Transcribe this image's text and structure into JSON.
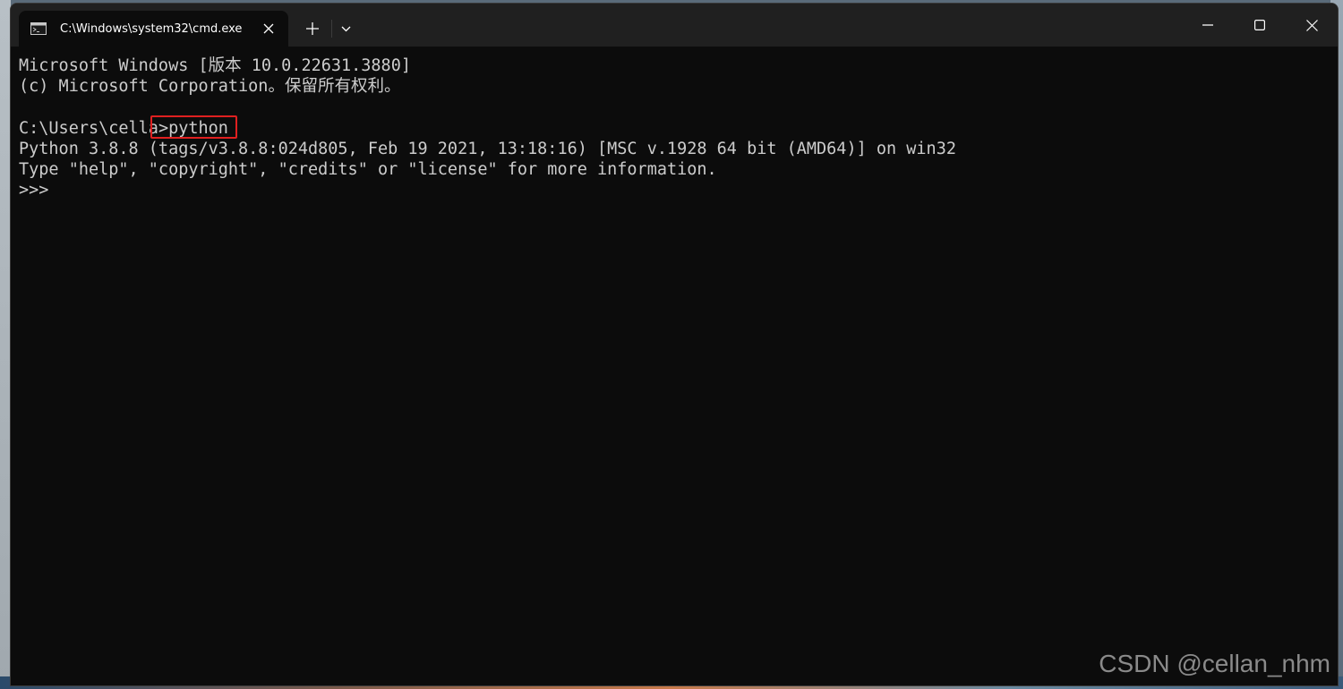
{
  "window": {
    "tab_title": "C:\\Windows\\system32\\cmd.exe",
    "controls": {
      "minimize_icon": "minimize-icon",
      "maximize_icon": "maximize-icon",
      "close_icon": "close-icon"
    }
  },
  "terminal": {
    "lines": [
      "Microsoft Windows [版本 10.0.22631.3880]",
      "(c) Microsoft Corporation。保留所有权利。",
      "",
      "C:\\Users\\cella>python",
      "Python 3.8.8 (tags/v3.8.8:024d805, Feb 19 2021, 13:18:16) [MSC v.1928 64 bit (AMD64)] on win32",
      "Type \"help\", \"copyright\", \"credits\" or \"license\" for more information.",
      ">>>"
    ],
    "prompt_prefix": "C:\\Users\\cella",
    "command": ">python",
    "colors": {
      "background": "#0c0c0c",
      "foreground": "#cccccc",
      "highlight_box": "#e02020"
    }
  },
  "watermark": "CSDN @cellan_nhm"
}
